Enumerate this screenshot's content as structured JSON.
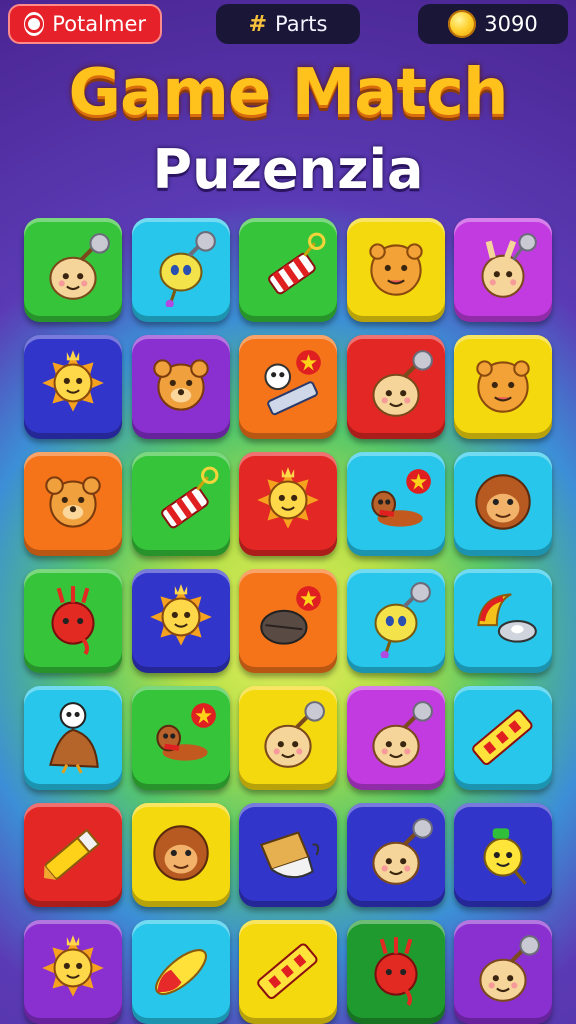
{
  "header": {
    "player_name": "Potalmer",
    "parts_label": "Parts",
    "parts_icon": "#",
    "coins": "3090"
  },
  "title": "Game Match",
  "subtitle": "Puzenzia",
  "colors": {
    "green": "#36c43a",
    "cyan": "#27c6ea",
    "yellow": "#f5d90f",
    "magenta": "#c23be0",
    "blue": "#3235c9",
    "purple": "#8a2fd0",
    "orange": "#f5741a",
    "red": "#e32725",
    "darkgreen": "#1f9a2e"
  },
  "board": {
    "rows": 7,
    "cols": 5,
    "tiles": [
      [
        {
          "color": "green",
          "icon": "seal-creature-icon"
        },
        {
          "color": "cyan",
          "icon": "rattle-creature-icon"
        },
        {
          "color": "green",
          "icon": "firecracker-icon"
        },
        {
          "color": "yellow",
          "icon": "lion-face-icon"
        },
        {
          "color": "magenta",
          "icon": "bunny-creature-icon"
        }
      ],
      [
        {
          "color": "blue",
          "icon": "sun-creature-icon"
        },
        {
          "color": "purple",
          "icon": "bear-face-icon"
        },
        {
          "color": "orange",
          "icon": "skull-rocket-icon"
        },
        {
          "color": "red",
          "icon": "seal-creature-icon"
        },
        {
          "color": "yellow",
          "icon": "lion-face-icon"
        }
      ],
      [
        {
          "color": "orange",
          "icon": "bear-face-icon"
        },
        {
          "color": "green",
          "icon": "firecracker-icon"
        },
        {
          "color": "red",
          "icon": "sun-creature-icon"
        },
        {
          "color": "cyan",
          "icon": "beaver-star-icon"
        },
        {
          "color": "cyan",
          "icon": "monkey-face-icon"
        }
      ],
      [
        {
          "color": "green",
          "icon": "red-blob-icon"
        },
        {
          "color": "blue",
          "icon": "sun-creature-icon"
        },
        {
          "color": "orange",
          "icon": "bomb-star-icon"
        },
        {
          "color": "cyan",
          "icon": "rattle-creature-icon"
        },
        {
          "color": "cyan",
          "icon": "helmet-icon"
        }
      ],
      [
        {
          "color": "cyan",
          "icon": "skull-bird-icon"
        },
        {
          "color": "green",
          "icon": "beaver-star-icon"
        },
        {
          "color": "yellow",
          "icon": "seal-creature-icon"
        },
        {
          "color": "magenta",
          "icon": "seal-creature-icon"
        },
        {
          "color": "cyan",
          "icon": "cracker-stick-icon"
        }
      ],
      [
        {
          "color": "red",
          "icon": "crayon-icon"
        },
        {
          "color": "yellow",
          "icon": "monkey-face-icon"
        },
        {
          "color": "blue",
          "icon": "book-icon"
        },
        {
          "color": "blue",
          "icon": "seal-creature-icon"
        },
        {
          "color": "blue",
          "icon": "pin-face-icon"
        }
      ],
      [
        {
          "color": "purple",
          "icon": "sun-creature-icon"
        },
        {
          "color": "cyan",
          "icon": "rocket-icon"
        },
        {
          "color": "yellow",
          "icon": "cracker-stick-icon"
        },
        {
          "color": "darkgreen",
          "icon": "red-blob-icon"
        },
        {
          "color": "purple",
          "icon": "seal-creature-icon"
        }
      ]
    ]
  }
}
